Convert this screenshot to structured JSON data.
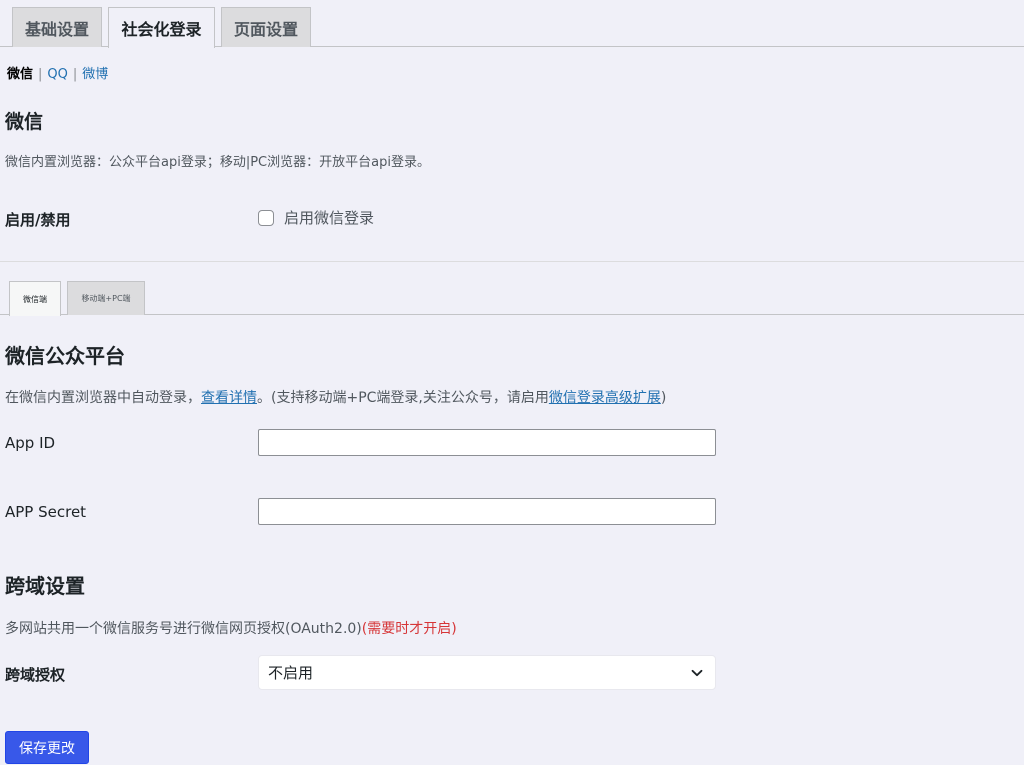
{
  "tabs": [
    "基础设置",
    "社会化登录",
    "页面设置"
  ],
  "subnav": {
    "current": "微信",
    "links": [
      "QQ",
      "微博"
    ],
    "separator": "|"
  },
  "wechat": {
    "title": "微信",
    "desc": "微信内置浏览器：公众平台api登录；移动|PC浏览器：开放平台api登录。",
    "enable_label": "启用/禁用",
    "enable_checkbox_label": "启用微信登录",
    "enable_checked": false
  },
  "inner_tabs": [
    "微信端",
    "移动端+PC端"
  ],
  "mp": {
    "title": "微信公众平台",
    "desc_prefix": "在微信内置浏览器中自动登录，",
    "desc_link": "查看详情",
    "desc_mid": "。(支持移动端+PC端登录,关注公众号，请启用",
    "desc_link2": "微信登录高级扩展",
    "desc_suffix": ")",
    "app_id_label": "App ID",
    "app_id_value": "",
    "app_secret_label": "APP Secret",
    "app_secret_value": ""
  },
  "cross": {
    "title": "跨域设置",
    "desc": "多网站共用一个微信服务号进行微信网页授权(OAuth2.0)",
    "desc_warn": "(需要时才开启)",
    "label": "跨域授权",
    "select_value": "不启用"
  },
  "save_label": "保存更改",
  "colors": {
    "primary": "#3858e9",
    "link": "#2271b1",
    "warning": "#d63638",
    "background": "#f0f0f8"
  }
}
